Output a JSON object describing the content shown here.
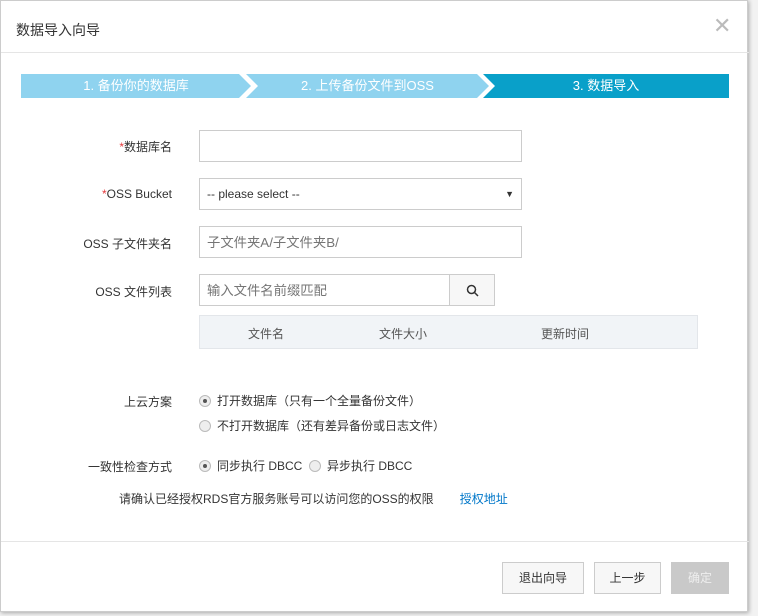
{
  "dialog": {
    "title": "数据导入向导"
  },
  "steps": [
    "1. 备份你的数据库",
    "2. 上传备份文件到OSS",
    "3. 数据导入"
  ],
  "form": {
    "db_name_label": "数据库名",
    "required_mark": "*",
    "db_name_value": "",
    "bucket_label": "OSS Bucket",
    "bucket_value": "-- please select --",
    "subfolder_label": "OSS 子文件夹名",
    "subfolder_placeholder": "子文件夹A/子文件夹B/",
    "filelist_label": "OSS 文件列表",
    "filelist_placeholder": "输入文件名前缀匹配",
    "table_headers": [
      "文件名",
      "文件大小",
      "更新时间"
    ],
    "plan_label": "上云方案",
    "plan_options": [
      "打开数据库（只有一个全量备份文件）",
      "不打开数据库（还有差异备份或日志文件）"
    ],
    "dbcc_label": "一致性检查方式",
    "dbcc_options": [
      "同步执行 DBCC",
      "异步执行 DBCC"
    ],
    "notice": "请确认已经授权RDS官方服务账号可以访问您的OSS的权限",
    "auth_link": "授权地址"
  },
  "footer": {
    "exit": "退出向导",
    "prev": "上一步",
    "ok": "确定"
  }
}
